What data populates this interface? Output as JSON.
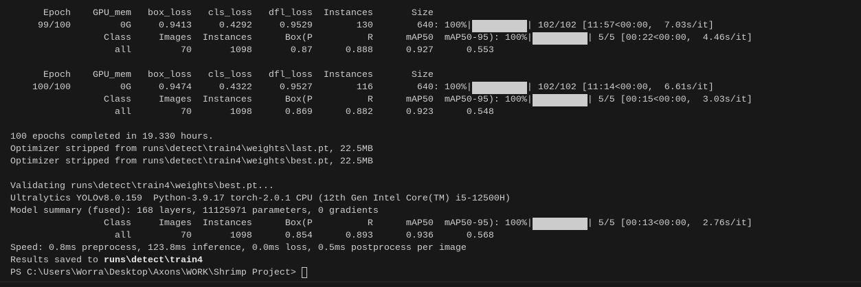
{
  "terminal": {
    "epoch99": {
      "header": "      Epoch    GPU_mem   box_loss   cls_loss   dfl_loss  Instances       Size",
      "train_pre": "     99/100         0G     0.9413     0.4292     0.9529        130        640: 100%|",
      "train_post": "| 102/102 [11:57<00:00,  7.03s/it]",
      "val_pre": "                 Class     Images  Instances      Box(P          R      mAP50  mAP50-95): 100%|",
      "val_post": "| 5/5 [00:22<00:00,  4.46s/it]",
      "val_result": "                   all         70       1098       0.87      0.888      0.927      0.553",
      "train_progress_percent": 100,
      "val_progress_percent": 100
    },
    "epoch100": {
      "header": "      Epoch    GPU_mem   box_loss   cls_loss   dfl_loss  Instances       Size",
      "train_pre": "    100/100         0G     0.9474     0.4322     0.9527        116        640: 100%|",
      "train_post": "| 102/102 [11:14<00:00,  6.61s/it]",
      "val_pre": "                 Class     Images  Instances      Box(P          R      mAP50  mAP50-95): 100%|",
      "val_post": "| 5/5 [00:15<00:00,  3.03s/it]",
      "val_result": "                   all         70       1098      0.869      0.882      0.923      0.548",
      "train_progress_percent": 100,
      "val_progress_percent": 100
    },
    "summary": {
      "completed": "100 epochs completed in 19.330 hours.",
      "stripped_last": "Optimizer stripped from runs\\detect\\train4\\weights\\last.pt, 22.5MB",
      "stripped_best": "Optimizer stripped from runs\\detect\\train4\\weights\\best.pt, 22.5MB"
    },
    "validation": {
      "validating": "Validating runs\\detect\\train4\\weights\\best.pt...",
      "env": "Ultralytics YOLOv8.0.159  Python-3.9.17 torch-2.0.1 CPU (12th Gen Intel Core(TM) i5-12500H)",
      "model_summary": "Model summary (fused): 168 layers, 11125971 parameters, 0 gradients",
      "val_pre": "                 Class     Images  Instances      Box(P          R      mAP50  mAP50-95): 100%|",
      "val_post": "| 5/5 [00:13<00:00,  2.76s/it]",
      "val_result": "                   all         70       1098      0.854      0.893      0.936      0.568",
      "val_progress_percent": 100,
      "speed": "Speed: 0.8ms preprocess, 123.8ms inference, 0.0ms loss, 0.5ms postprocess per image",
      "results_prefix": "Results saved to ",
      "results_path": "runs\\detect\\train4"
    },
    "prompt": "PS C:\\Users\\Worra\\Desktop\\Axons\\WORK\\Shrimp Project>"
  }
}
